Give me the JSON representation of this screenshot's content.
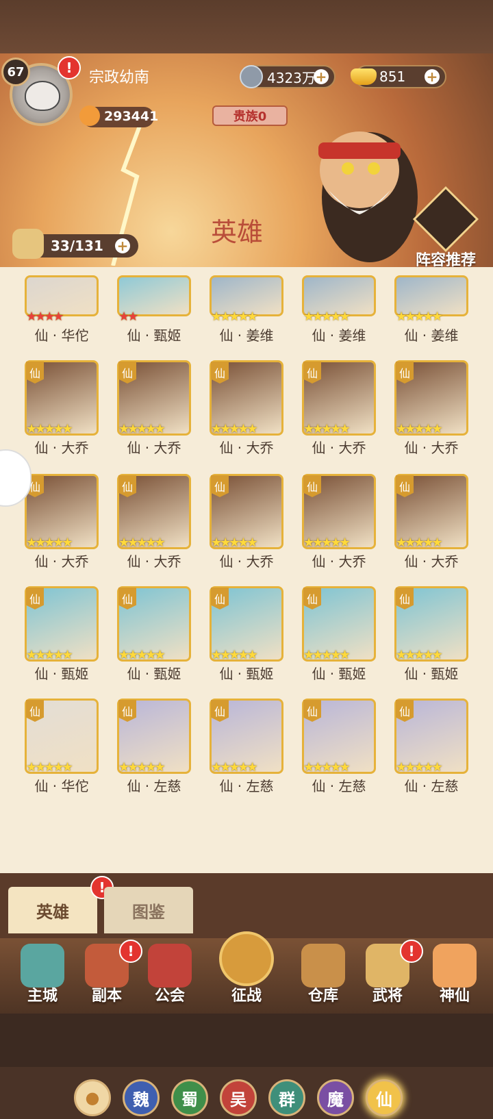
{
  "player": {
    "level": "67",
    "name": "宗政幼南",
    "paw_points": "293441",
    "noble": "贵族0"
  },
  "currency": {
    "coins": "4323万",
    "ingots": "851"
  },
  "hero_count": "33/131",
  "lineup_label": "阵容推荐",
  "banner_text": "英雄",
  "alert_mark": "!",
  "plus_mark": "+",
  "rows": [
    {
      "cards": [
        {
          "tag": "",
          "stars": "★★★★",
          "label": "仙 · 华佗",
          "color": "#dcd6cf"
        },
        {
          "tag": "",
          "stars": "★★",
          "label": "仙 · 甄姬",
          "color": "#8fc9d6"
        },
        {
          "tag": "",
          "stars": "★★★★★",
          "label": "仙 · 姜维",
          "color": "#9fb6c9"
        },
        {
          "tag": "",
          "stars": "★★★★★",
          "label": "仙 · 姜维",
          "color": "#9fb6c9"
        },
        {
          "tag": "",
          "stars": "★★★★★",
          "label": "仙 · 姜维",
          "color": "#9fb6c9"
        }
      ]
    },
    {
      "cards": [
        {
          "tag": "仙",
          "stars": "★★★★★",
          "label": "仙 · 大乔",
          "color": "#7a5137"
        },
        {
          "tag": "仙",
          "stars": "★★★★★",
          "label": "仙 · 大乔",
          "color": "#7a5137"
        },
        {
          "tag": "仙",
          "stars": "★★★★★",
          "label": "仙 · 大乔",
          "color": "#7a5137"
        },
        {
          "tag": "仙",
          "stars": "★★★★★",
          "label": "仙 · 大乔",
          "color": "#7a5137"
        },
        {
          "tag": "仙",
          "stars": "★★★★★",
          "label": "仙 · 大乔",
          "color": "#7a5137"
        }
      ]
    },
    {
      "cards": [
        {
          "tag": "仙",
          "stars": "★★★★★",
          "label": "仙 · 大乔",
          "color": "#7a5137"
        },
        {
          "tag": "仙",
          "stars": "★★★★★",
          "label": "仙 · 大乔",
          "color": "#7a5137"
        },
        {
          "tag": "仙",
          "stars": "★★★★★",
          "label": "仙 · 大乔",
          "color": "#7a5137"
        },
        {
          "tag": "仙",
          "stars": "★★★★★",
          "label": "仙 · 大乔",
          "color": "#7a5137"
        },
        {
          "tag": "仙",
          "stars": "★★★★★",
          "label": "仙 · 大乔",
          "color": "#7a5137"
        }
      ]
    },
    {
      "cards": [
        {
          "tag": "仙",
          "stars": "★★★★★",
          "label": "仙 · 甄姬",
          "color": "#7fc4d3"
        },
        {
          "tag": "仙",
          "stars": "★★★★★",
          "label": "仙 · 甄姬",
          "color": "#7fc4d3"
        },
        {
          "tag": "仙",
          "stars": "★★★★★",
          "label": "仙 · 甄姬",
          "color": "#7fc4d3"
        },
        {
          "tag": "仙",
          "stars": "★★★★★",
          "label": "仙 · 甄姬",
          "color": "#7fc4d3"
        },
        {
          "tag": "仙",
          "stars": "★★★★★",
          "label": "仙 · 甄姬",
          "color": "#7fc4d3"
        }
      ]
    },
    {
      "cards": [
        {
          "tag": "仙",
          "stars": "★★★★★",
          "label": "仙 · 华佗",
          "color": "#e3ddd5"
        },
        {
          "tag": "仙",
          "stars": "★★★★★",
          "label": "仙 · 左慈",
          "color": "#b9b6d8"
        },
        {
          "tag": "仙",
          "stars": "★★★★★",
          "label": "仙 · 左慈",
          "color": "#b9b6d8"
        },
        {
          "tag": "仙",
          "stars": "★★★★★",
          "label": "仙 · 左慈",
          "color": "#b9b6d8"
        },
        {
          "tag": "仙",
          "stars": "★★★★★",
          "label": "仙 · 左慈",
          "color": "#b9b6d8"
        }
      ]
    }
  ],
  "filters": [
    {
      "label": "",
      "icon": "paw-icon",
      "color": "#f0d7a5"
    },
    {
      "label": "魏",
      "color": "#3f5fb0"
    },
    {
      "label": "蜀",
      "color": "#3f8f4a"
    },
    {
      "label": "吴",
      "color": "#c2433a"
    },
    {
      "label": "群",
      "color": "#3f8f7a"
    },
    {
      "label": "魔",
      "color": "#7a4fa3"
    },
    {
      "label": "仙",
      "color": "#f1c24a"
    }
  ],
  "tabs": {
    "heroes": "英雄",
    "catalog": "图鉴"
  },
  "nav": [
    {
      "label": "主城",
      "icon": "city-icon",
      "color": "#5aa6a0"
    },
    {
      "label": "副本",
      "icon": "sword-icon",
      "color": "#c35b3b"
    },
    {
      "label": "公会",
      "icon": "flag-icon",
      "color": "#c2433a"
    },
    {
      "label": "征战",
      "icon": "battle-icon",
      "color": "#d79b3c"
    },
    {
      "label": "仓库",
      "icon": "bag-icon",
      "color": "#c9904a"
    },
    {
      "label": "武将",
      "icon": "cat-icon",
      "color": "#e0b566"
    },
    {
      "label": "神仙",
      "icon": "cat-icon",
      "color": "#f0a35e"
    }
  ]
}
